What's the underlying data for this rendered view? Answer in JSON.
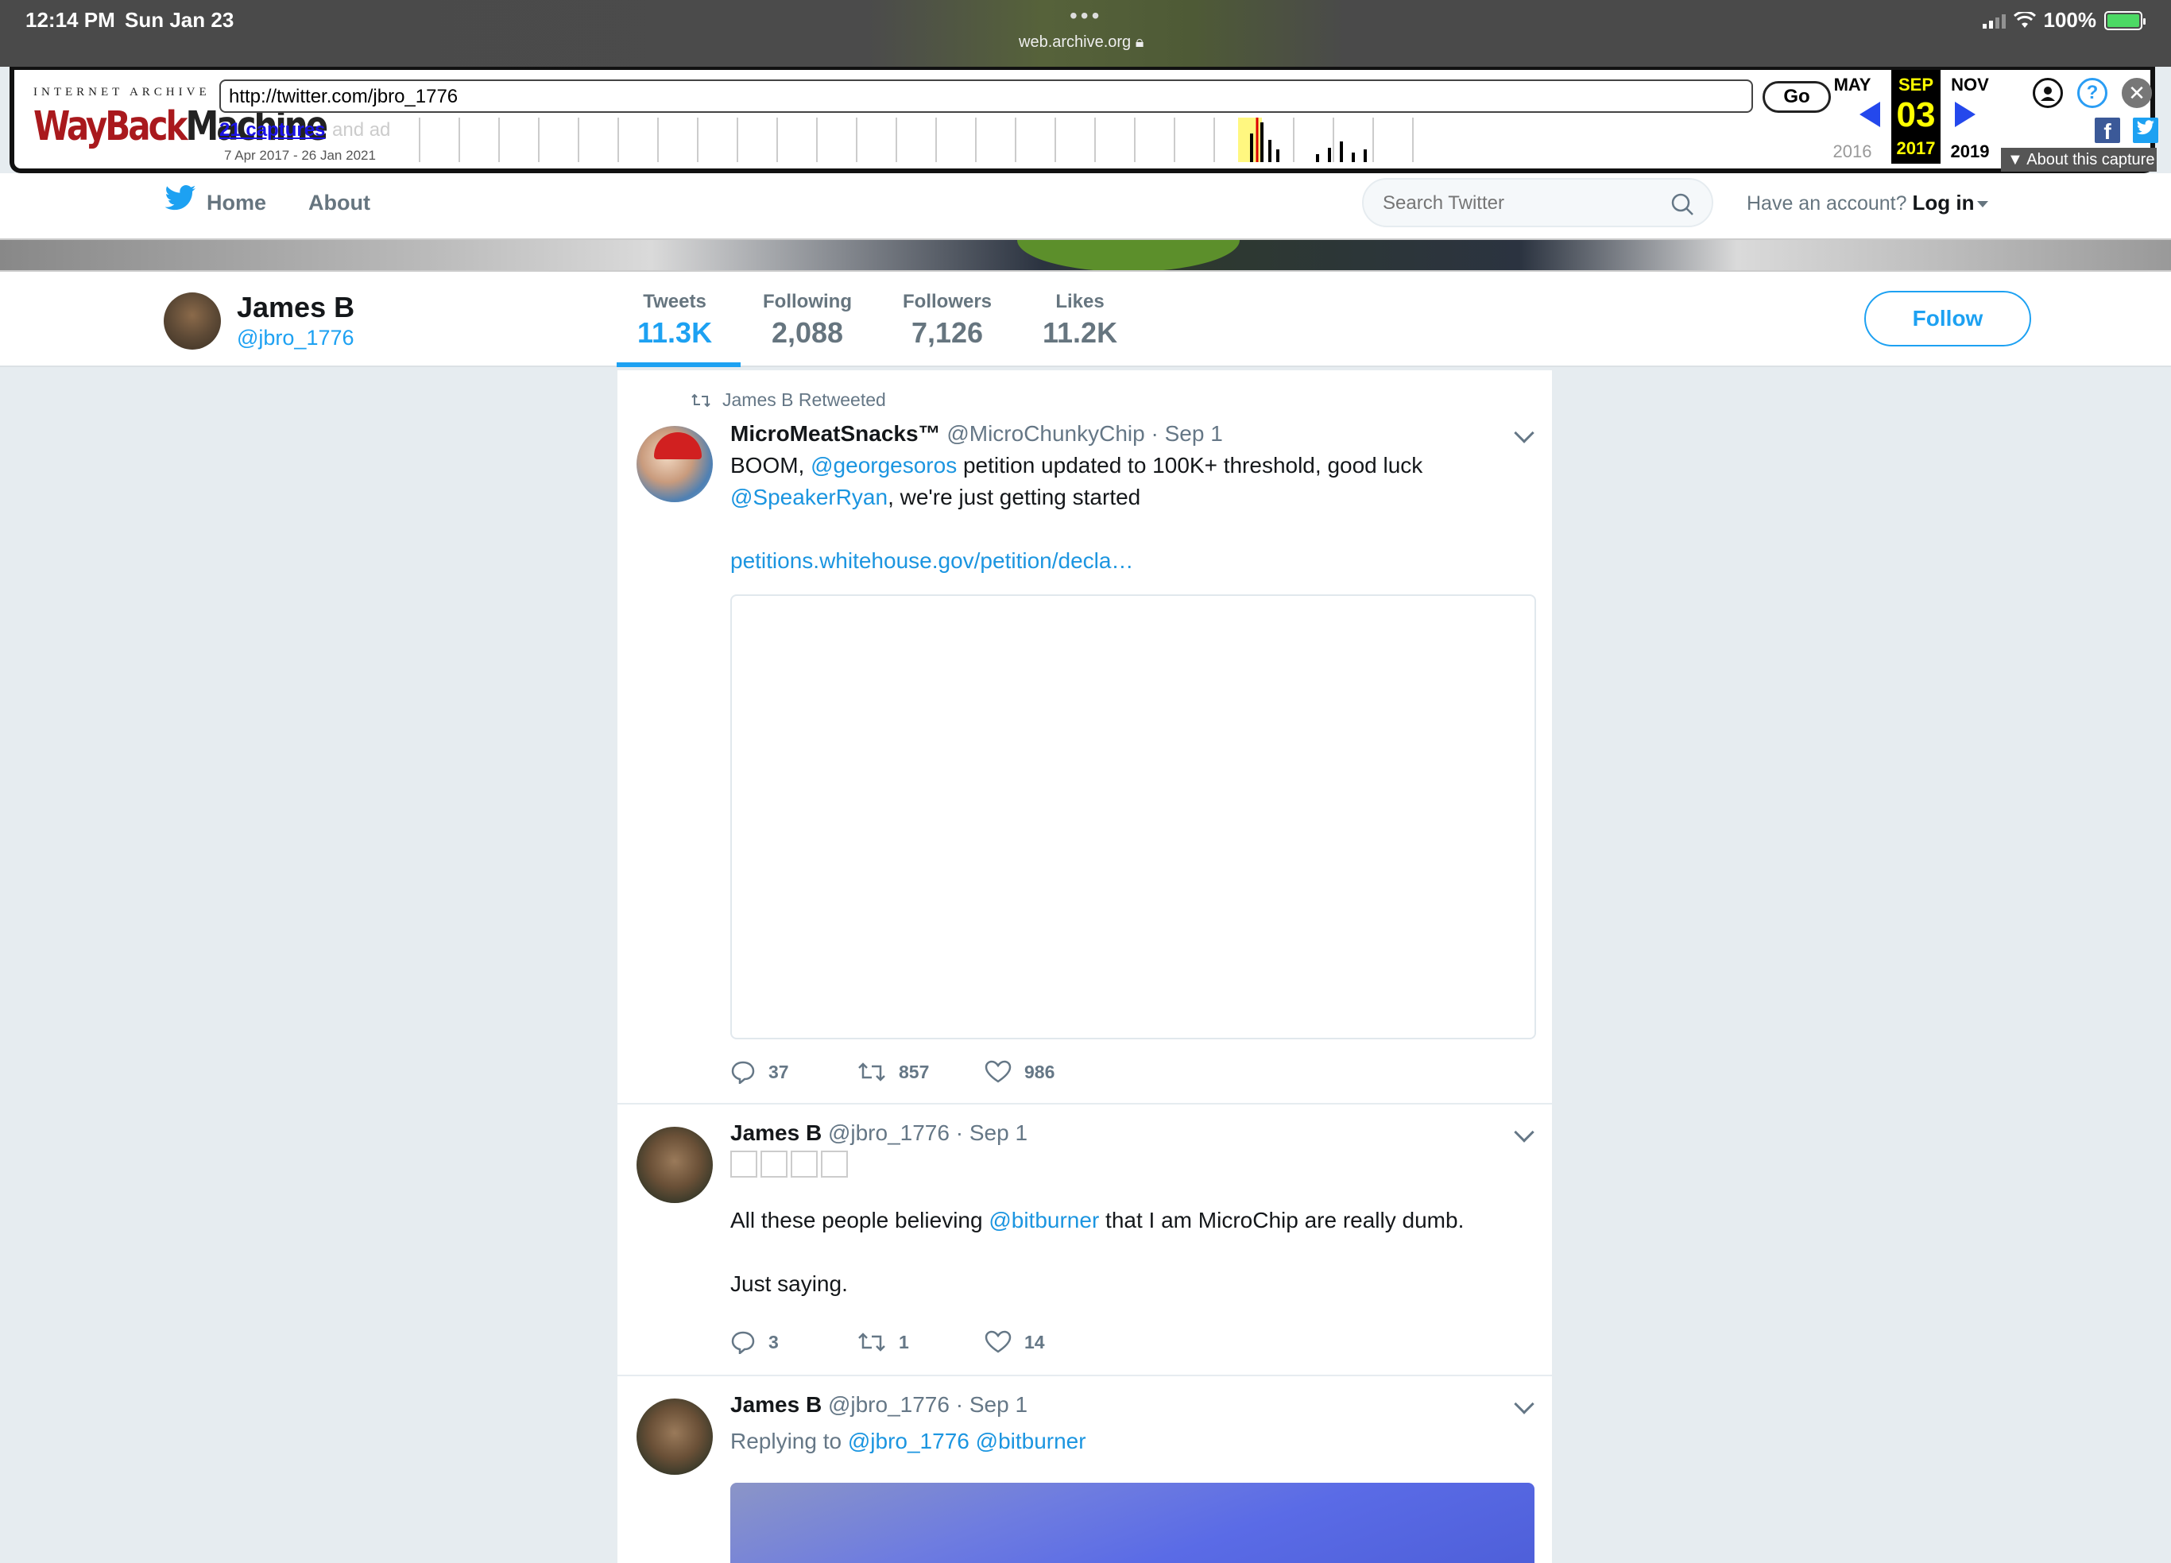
{
  "status_bar": {
    "time": "12:14 PM",
    "date": "Sun Jan 23",
    "url": "web.archive.org",
    "battery": "100%"
  },
  "wayback": {
    "logo_top": "INTERNET ARCHIVE",
    "logo_main_1": "WayBack",
    "logo_main_2": "Machine",
    "url_value": "http://twitter.com/jbro_1776",
    "go_label": "Go",
    "captures_label": "21 captures",
    "capture_range": "7 Apr 2017 - 26 Jan 2021",
    "ghost_text": "and ad",
    "prev_month": "MAY",
    "cur_month": "SEP",
    "next_month": "NOV",
    "cur_day": "03",
    "prev_year": "2016",
    "cur_year": "2017",
    "next_year": "2019",
    "about_capture": "About this capture",
    "fb_icon_text": "f",
    "help_icon_text": "?",
    "close_icon_text": "✕"
  },
  "twitter_nav": {
    "home": "Home",
    "about": "About",
    "search_placeholder": "Search Twitter",
    "account_prompt": "Have an account?",
    "login": "Log in"
  },
  "profile": {
    "name": "James B",
    "handle": "@jbro_1776",
    "follow_label": "Follow",
    "stats": [
      {
        "label": "Tweets",
        "value": "11.3K"
      },
      {
        "label": "Following",
        "value": "2,088"
      },
      {
        "label": "Followers",
        "value": "7,126"
      },
      {
        "label": "Likes",
        "value": "11.2K"
      }
    ]
  },
  "tweets": [
    {
      "context": "James B Retweeted",
      "name": "MicroMeatSnacks™",
      "handle": "@MicroChunkyChip",
      "date": "· Sep 1",
      "text_1": "BOOM, ",
      "mention_1": "@georgesoros",
      "text_2": " petition updated to 100K+ threshold, good luck",
      "mention_2": "@SpeakerRyan",
      "text_3": ", we're just getting started",
      "link": "petitions.whitehouse.gov/petition/decla…",
      "replies": "37",
      "retweets": "857",
      "likes": "986"
    },
    {
      "name": "James B",
      "handle": "@jbro_1776",
      "date": "· Sep 1",
      "text_1": "All these people believing ",
      "mention_1": "@bitburner",
      "text_2": " that I am MicroChip are really dumb.",
      "text_3": "Just saying.",
      "replies": "3",
      "retweets": "1",
      "likes": "14"
    },
    {
      "name": "James B",
      "handle": "@jbro_1776",
      "date": "· Sep 1",
      "reply_prefix": "Replying to ",
      "reply_1": "@jbro_1776",
      "reply_2": "@bitburner"
    }
  ],
  "colors": {
    "twitter_blue": "#1da1f2",
    "link_blue": "#1b95e0",
    "timeline_bg": "#e6ecf0",
    "wayback_red": "#a9191d",
    "wayback_year_highlight": "#ffff00"
  },
  "icons": {
    "signal": "cellular-signal-icon",
    "wifi": "wifi-icon",
    "battery": "battery-charging-icon",
    "lock": "lock-icon",
    "twitter": "twitter-bird-icon",
    "search": "magnifier-icon",
    "reply": "reply-bubble-icon",
    "retweet": "retweet-icon",
    "like": "heart-icon",
    "menu": "chevron-down-icon"
  }
}
